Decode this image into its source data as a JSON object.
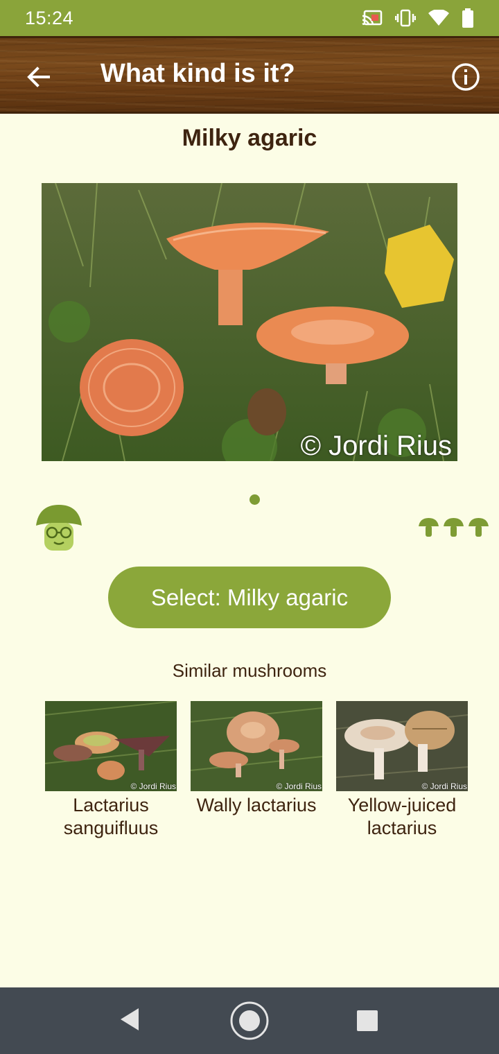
{
  "status_bar": {
    "time": "15:24",
    "icons": [
      "cast-icon",
      "vibrate-icon",
      "wifi-icon",
      "battery-icon"
    ]
  },
  "app_bar": {
    "title": "What kind is it?",
    "back_icon": "arrow-left-icon",
    "info_icon": "info-icon"
  },
  "mushroom": {
    "name": "Milky agaric",
    "photo_credit": "© Jordi Rius",
    "carousel_pages": 1
  },
  "select_button": {
    "label": "Select: Milky agaric"
  },
  "similar": {
    "title": "Similar mushrooms",
    "items": [
      {
        "name": "Lactarius sanguifluus",
        "credit": "© Jordi Rius"
      },
      {
        "name": "Wally lactarius",
        "credit": "© Jordi Rius"
      },
      {
        "name": "Yellow-juiced lactarius",
        "credit": "© Jordi Rius"
      }
    ]
  },
  "colors": {
    "accent": "#8ba73a",
    "status_bar": "#8aa43a",
    "background": "#fcfde6",
    "text": "#3e2410",
    "nav_bar": "#434a52"
  },
  "difficulty_icons": [
    "mushroom-icon",
    "mushroom-icon",
    "mushroom-icon"
  ]
}
